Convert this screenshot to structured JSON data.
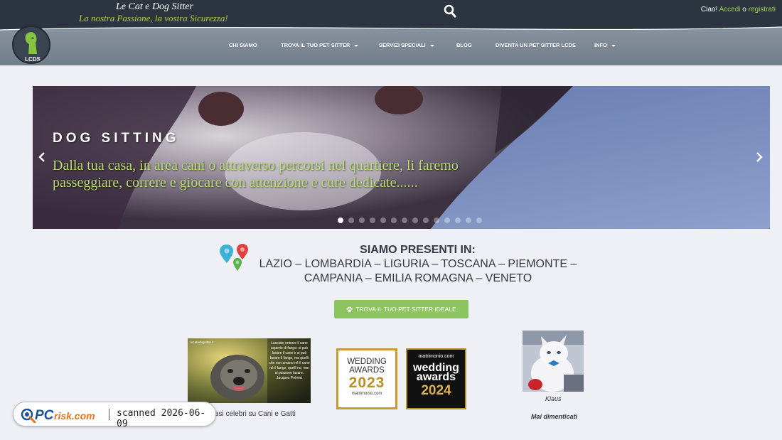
{
  "header": {
    "brand_title": "Le Cat e Dog Sitter",
    "brand_slogan": "La nostra Passione, la vostra Sicurezza!",
    "search_icon": "search-icon",
    "account": {
      "greeting": "Ciao!",
      "login": "Accedi",
      "or": "o",
      "register": "registrati"
    }
  },
  "nav": {
    "logo_text": "LCDS",
    "items": [
      {
        "label": "CHI SIAMO",
        "dropdown": false
      },
      {
        "label": "TROVA IL TUO PET SITTER",
        "dropdown": true
      },
      {
        "label": "SERVIZI SPECIALI",
        "dropdown": true
      },
      {
        "label": "BLOG",
        "dropdown": false
      },
      {
        "label": "DIVENTA UN PET SITTER LCDS",
        "dropdown": false
      },
      {
        "label": "INFO",
        "dropdown": true
      }
    ]
  },
  "hero": {
    "title": "DOG SITTING",
    "text": "Dalla tua casa, in area cani o attraverso percorsi nel quartiere, li faremo passeggiare, correre e giocare con attenzione e cure dedicate......",
    "prev_icon": "chevron-left-icon",
    "next_icon": "chevron-right-icon",
    "slide_count": 14,
    "active_slide": 1
  },
  "presence": {
    "title": "SIAMO PRESENTI IN:",
    "regions": "LAZIO – LOMBARDIA – LIGURIA – TOSCANA – PIEMONTE – CAMPANIA – EMILIA ROMAGNA – VENETO",
    "icon": "map-pins-icon"
  },
  "cta": {
    "label": "TROVA IL TUO PET SITTER IDEALE",
    "icon": "paw-icon"
  },
  "cards": {
    "dog_card": {
      "site": "lecatedogsitter.it",
      "quote": "Lasciate entrare il cane coperto di fango: si può lavare il cane e si può lavare il fango, ma quelli che non amano né il cane né il fango, quelli no, non si possono lavare.",
      "author": "Jacques Prévert",
      "caption": "i, frasi celebri su Cani e Gatti"
    },
    "award_2023": {
      "line1": "WEDDING",
      "line2": "AWARDS",
      "year": "2023",
      "brand": "matrimonio.com"
    },
    "award_2024": {
      "brand": "matrimonio.com",
      "line1": "wedding",
      "line2": "awards",
      "year": "2024"
    },
    "cat_card": {
      "name": "Klaus",
      "caption": "Mai dimenticati"
    }
  },
  "watermark": {
    "brand": "PCrisk.com",
    "text": "scanned 2026-06-09"
  },
  "colors": {
    "topbar": "#2c3440",
    "accent_green": "#8cc560",
    "slogan": "#b5cf3a",
    "hero_text": "#b6dd6b",
    "gold": "#b8902b"
  }
}
